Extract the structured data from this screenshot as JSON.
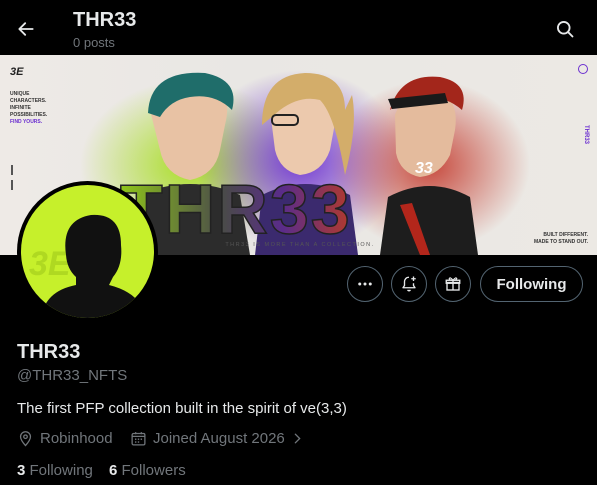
{
  "header": {
    "title": "THR33",
    "posts_count": "0 posts"
  },
  "banner": {
    "logo": "3E",
    "tagline": [
      "UNIQUE",
      "CHARACTERS.",
      "INFINITE",
      "POSSIBILITIES.",
      "FIND YOURS."
    ],
    "big_text": "THR33",
    "caption": "THR33 IS MORE THAN A COLLECTION.",
    "right_note": [
      "BUILT DIFFERENT.",
      "MADE TO STAND OUT."
    ],
    "side_text": "THR33",
    "badge_number": "33",
    "colors": {
      "accent_green": "#9fd11b",
      "accent_purple": "#7a3fd6",
      "accent_red": "#c83a2a"
    }
  },
  "avatar": {
    "bg_color": "#c6f02b",
    "watermark": "3E"
  },
  "actions": {
    "more_icon": "more-icon",
    "notify_icon": "bell-plus-icon",
    "gift_icon": "gift-icon",
    "following_label": "Following"
  },
  "profile": {
    "name": "THR33",
    "handle": "@THR33_NFTS",
    "bio": "The first PFP collection built in the spirit of ve(3,3)",
    "location": "Robinhood",
    "joined": "Joined August 2026",
    "following_count": "3",
    "following_label": "Following",
    "followers_count": "6",
    "followers_label": "Followers"
  }
}
